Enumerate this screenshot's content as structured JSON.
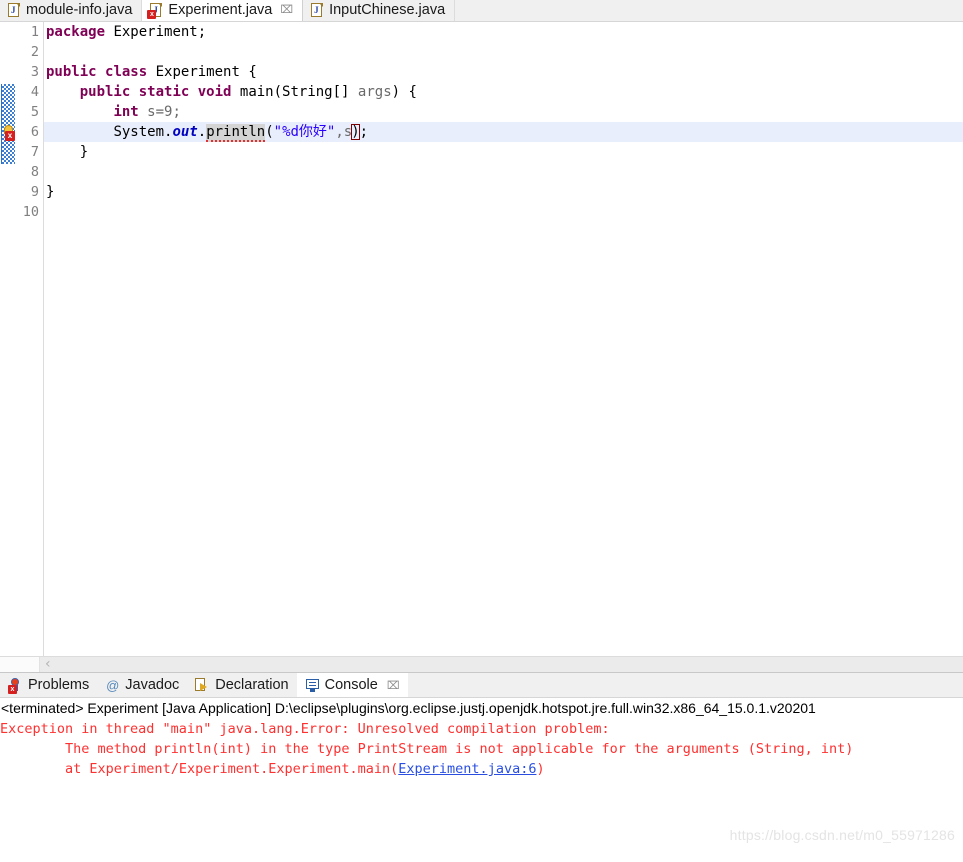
{
  "editor_tabs": [
    {
      "label": "module-info.java",
      "icon": "java-file-icon",
      "active": false,
      "error": false,
      "closable": false
    },
    {
      "label": "Experiment.java",
      "icon": "java-file-error-icon",
      "active": true,
      "error": true,
      "closable": true,
      "close_glyph": "⌧"
    },
    {
      "label": "InputChinese.java",
      "icon": "java-file-icon",
      "active": false,
      "error": false,
      "closable": false
    }
  ],
  "editor": {
    "line_numbers": [
      "1",
      "2",
      "3",
      "4",
      "5",
      "6",
      "7",
      "8",
      "9",
      "10"
    ],
    "code_lines": [
      {
        "n": 1,
        "text": "package Experiment;"
      },
      {
        "n": 2,
        "text": ""
      },
      {
        "n": 3,
        "text": "public class Experiment {"
      },
      {
        "n": 4,
        "text": "    public static void main(String[] args) {"
      },
      {
        "n": 5,
        "text": "        int s=9;"
      },
      {
        "n": 6,
        "text": "        System.out.println(\"%d你好\",s);"
      },
      {
        "n": 7,
        "text": "    }"
      },
      {
        "n": 8,
        "text": ""
      },
      {
        "n": 9,
        "text": "}"
      },
      {
        "n": 10,
        "text": ""
      }
    ],
    "l1_kw": "package",
    "l1_rest": " Experiment;",
    "l3_kw1": "public",
    "l3_kw2": "class",
    "l3_rest": " Experiment {",
    "l4_indent": "    ",
    "l4_kw1": "public",
    "l4_kw2": "static",
    "l4_kw3": "void",
    "l4_name": " main(String[] ",
    "l4_param": "args",
    "l4_tail": ") {",
    "l5_indent": "        ",
    "l5_kw": "int",
    "l5_rest": " s=9;",
    "l6_indent": "        ",
    "l6_sys": "System.",
    "l6_out": "out",
    "l6_dot": ".",
    "l6_method": "println",
    "l6_paren": "(",
    "l6_string": "\"%d你好\"",
    "l6_comma": ",s",
    "l6_closeparen": ")",
    "l6_semi": ";",
    "l7_text": "    }",
    "l9_text": "}",
    "highlighted_line": 6,
    "error_line": 6,
    "fold_line": 4,
    "marker_icon": "quickfix-error-bulb-icon",
    "scroll_arrow": "‹"
  },
  "panel_tabs": [
    {
      "label": "Problems",
      "icon": "problems-error-icon",
      "active": false,
      "closable": false
    },
    {
      "label": "Javadoc",
      "icon": "javadoc-at-icon",
      "active": false,
      "closable": false
    },
    {
      "label": "Declaration",
      "icon": "declaration-arrow-icon",
      "active": false,
      "closable": false
    },
    {
      "label": "Console",
      "icon": "console-monitor-icon",
      "active": true,
      "closable": true,
      "close_glyph": "⌧"
    }
  ],
  "console": {
    "header": "<terminated> Experiment [Java Application] D:\\eclipse\\plugins\\org.eclipse.justj.openjdk.hotspot.jre.full.win32.x86_64_15.0.1.v20201",
    "line1": "Exception in thread \"main\" java.lang.Error: Unresolved compilation problem: ",
    "line2": "\tThe method println(int) in the type PrintStream is not applicable for the arguments (String, int)",
    "line3": "",
    "line4_prefix": "\tat Experiment/Experiment.Experiment.main(",
    "line4_link": "Experiment.java:6",
    "line4_suffix": ")"
  },
  "watermark": "https://blog.csdn.net/m0_55971286",
  "colors": {
    "keyword": "#7f0055",
    "string": "#2a00ff",
    "field": "#0000c0",
    "error_text": "#ff3030",
    "link": "#2a4fe0",
    "highlight_row": "#e8eefb",
    "annotation_hatch": "#3b7fd4"
  }
}
